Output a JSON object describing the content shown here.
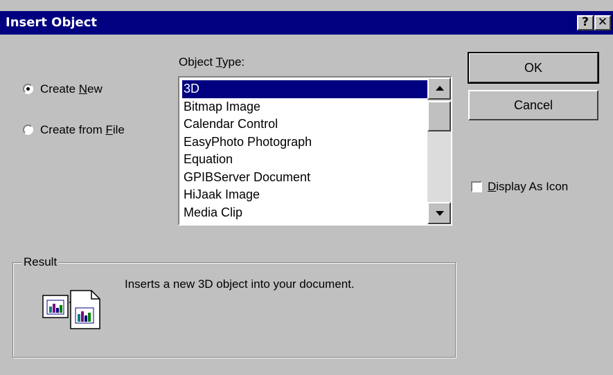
{
  "window": {
    "title": "Insert Object",
    "help_glyph": "?",
    "close_glyph": "✕"
  },
  "options": {
    "create_new": {
      "label_pre": "Create ",
      "label_key": "N",
      "label_post": "ew",
      "selected": true
    },
    "create_from_file": {
      "label_pre": "Create from ",
      "label_key": "F",
      "label_post": "ile",
      "selected": false
    }
  },
  "object_type": {
    "label_pre": "Object ",
    "label_key": "T",
    "label_post": "ype:",
    "items": [
      "3D",
      "Bitmap Image",
      "Calendar Control",
      "EasyPhoto Photograph",
      "Equation",
      "GPIBServer Document",
      "HiJaak Image",
      "Media Clip"
    ],
    "selected": "3D"
  },
  "buttons": {
    "ok": "OK",
    "cancel": "Cancel"
  },
  "display_as_icon": {
    "label_key": "D",
    "label_post": "isplay As Icon",
    "checked": false
  },
  "result": {
    "title": "Result",
    "text": "Inserts a new 3D object into your document."
  },
  "icons": [
    "radio-selected-icon",
    "radio-unselected-icon",
    "scroll-up-arrow-icon",
    "scroll-down-arrow-icon",
    "insert-object-result-icon"
  ],
  "colors": {
    "face": "#c0c0c0",
    "title_bar": "#000080",
    "selection": "#000080",
    "window_bg": "#ffffff"
  }
}
